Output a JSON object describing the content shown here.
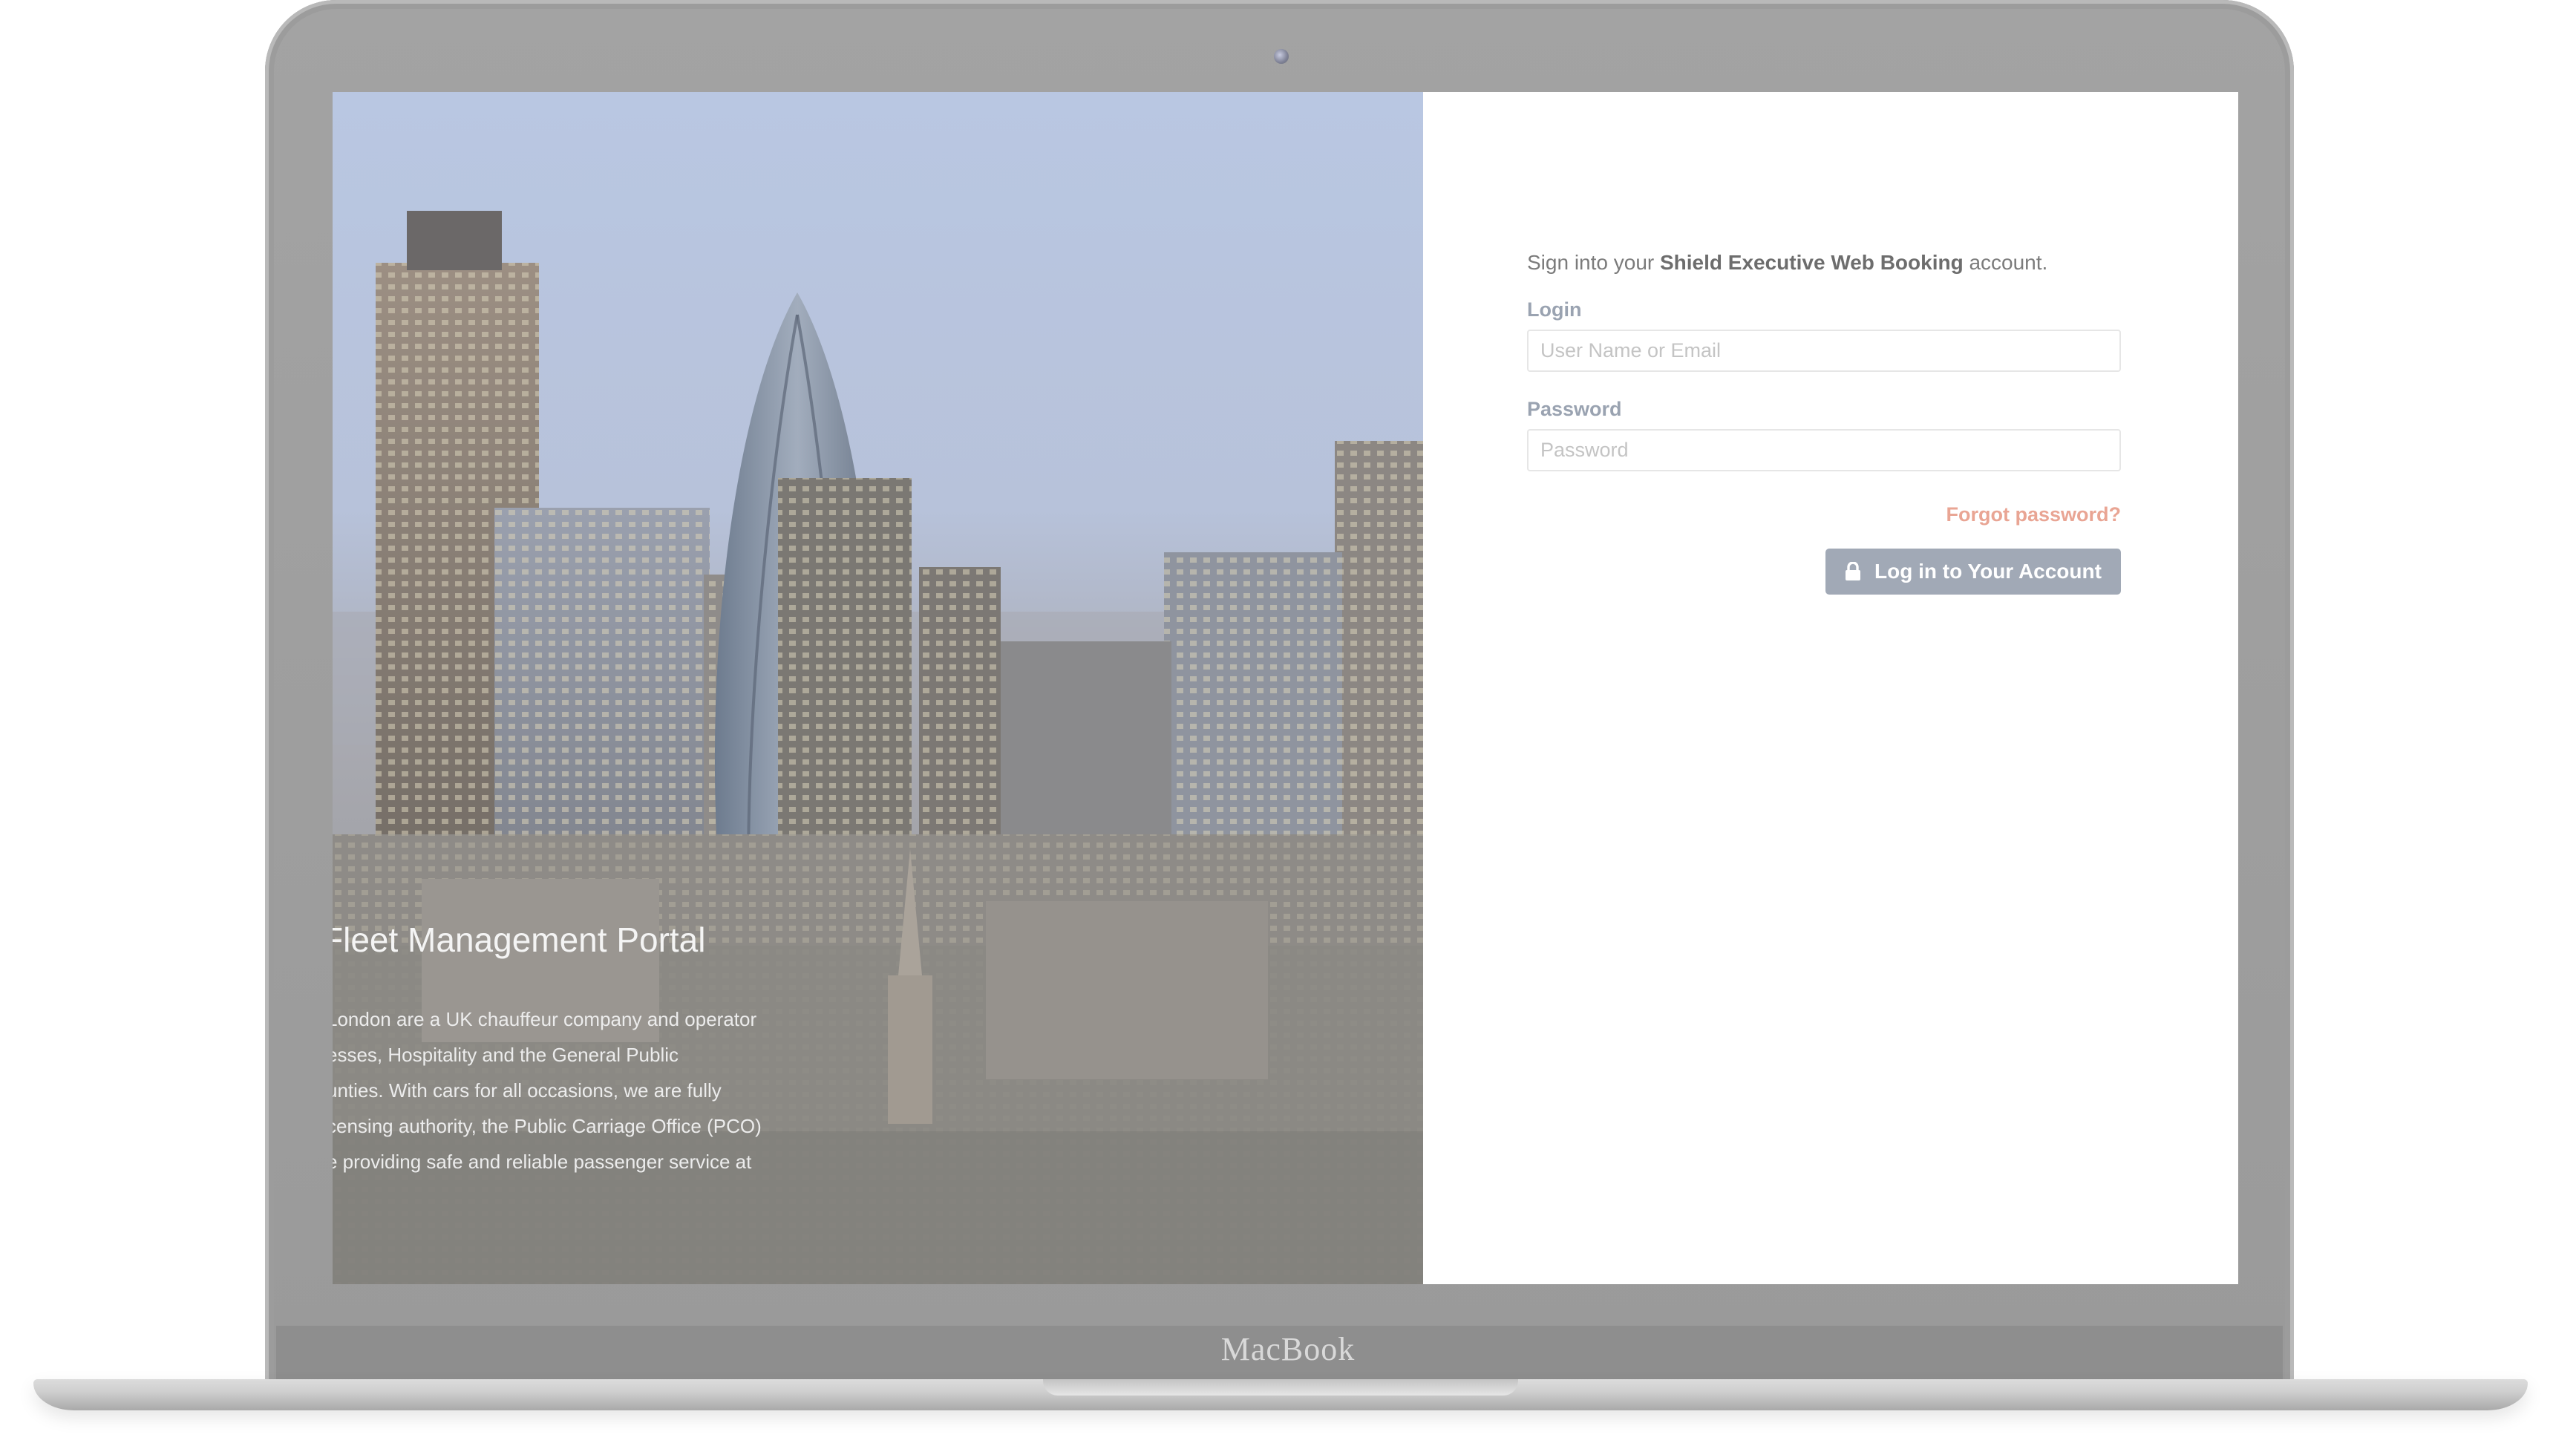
{
  "device": {
    "brand_label": "MacBook"
  },
  "hero": {
    "title": "Fleet Management Portal",
    "description_lines": [
      "London are a UK chauffeur company and operator",
      "esses, Hospitality and the General Public",
      "unties. With cars for all occasions, we are fully",
      "censing authority, the Public Carriage Office (PCO)",
      "e providing safe and reliable passenger service at"
    ]
  },
  "login": {
    "intro_prefix": "Sign into your ",
    "intro_brand": "Shield Executive Web Booking",
    "intro_suffix": " account.",
    "login_label": "Login",
    "login_placeholder": "User Name or Email",
    "password_label": "Password",
    "password_placeholder": "Password",
    "forgot_label": "Forgot password?",
    "submit_label": "Log in to Your Account",
    "submit_icon": "lock-icon"
  },
  "colors": {
    "accent_link": "#e9a594",
    "button_bg": "#a1a9b6",
    "label": "#9aa3b1"
  }
}
